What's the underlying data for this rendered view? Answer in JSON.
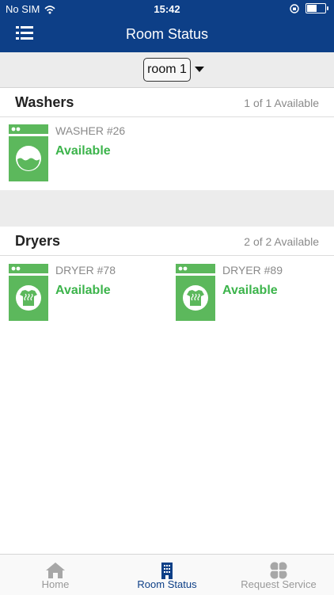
{
  "status_bar": {
    "carrier": "No SIM",
    "time": "15:42"
  },
  "header": {
    "title": "Room Status"
  },
  "room_selector": {
    "value": "room 1"
  },
  "washers": {
    "title": "Washers",
    "availability": "1 of 1 Available",
    "machines": [
      {
        "name": "WASHER #26",
        "status": "Available"
      }
    ]
  },
  "dryers": {
    "title": "Dryers",
    "availability": "2 of 2 Available",
    "machines": [
      {
        "name": "DRYER #78",
        "status": "Available"
      },
      {
        "name": "DRYER #89",
        "status": "Available"
      }
    ]
  },
  "tabbar": {
    "items": [
      {
        "label": "Home",
        "icon": "home-icon"
      },
      {
        "label": "Room Status",
        "icon": "building-icon"
      },
      {
        "label": "Request Service",
        "icon": "service-icon"
      }
    ]
  },
  "colors": {
    "header": "#0d3f87",
    "available": "#3cb44b",
    "machine_icon": "#5cb85c"
  }
}
